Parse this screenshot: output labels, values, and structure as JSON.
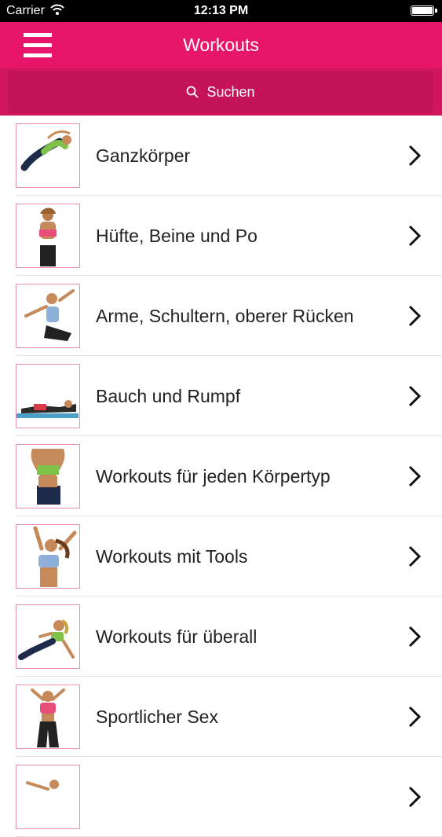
{
  "status_bar": {
    "carrier": "Carrier",
    "time": "12:13 PM"
  },
  "nav": {
    "title": "Workouts"
  },
  "search": {
    "placeholder": "Suchen"
  },
  "list": {
    "items": [
      {
        "label": "Ganzkörper",
        "icon": "workout-photo"
      },
      {
        "label": "Hüfte, Beine und Po",
        "icon": "workout-photo"
      },
      {
        "label": "Arme, Schultern, oberer Rücken",
        "icon": "workout-photo"
      },
      {
        "label": "Bauch und Rumpf",
        "icon": "workout-photo"
      },
      {
        "label": "Workouts für jeden Körpertyp",
        "icon": "workout-photo"
      },
      {
        "label": "Workouts mit Tools",
        "icon": "workout-photo"
      },
      {
        "label": "Workouts für überall",
        "icon": "workout-photo"
      },
      {
        "label": "Sportlicher Sex",
        "icon": "workout-photo"
      }
    ]
  },
  "colors": {
    "nav": "#e8166a",
    "search_bar": "#d01660",
    "thumb_border": "#e890b6"
  }
}
